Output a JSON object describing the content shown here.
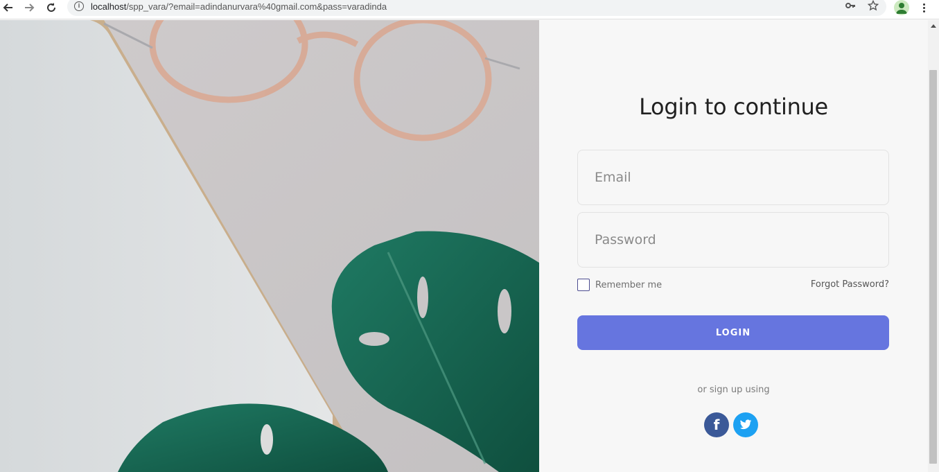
{
  "browser": {
    "url_host": "localhost",
    "url_rest": "/spp_vara/?email=adindanurvara%40gmail.com&pass=varadinda",
    "icons": [
      "back-arrow-icon",
      "forward-arrow-icon",
      "reload-icon",
      "site-info-icon",
      "key-icon",
      "star-icon",
      "profile-avatar-icon",
      "kebab-menu-icon"
    ]
  },
  "login": {
    "title": "Login to continue",
    "email_placeholder": "Email",
    "password_placeholder": "Password",
    "remember_label": "Remember me",
    "forgot_label": "Forgot Password?",
    "button_label": "LOGIN",
    "alt_signup": "or sign up using",
    "social": [
      {
        "name": "facebook",
        "glyph": "f",
        "color": "#3b5998"
      },
      {
        "name": "twitter",
        "glyph": "twitter-bird",
        "color": "#1da1f2"
      }
    ]
  },
  "colors": {
    "accent": "#6675df",
    "panel_bg": "#f7f7f7"
  }
}
